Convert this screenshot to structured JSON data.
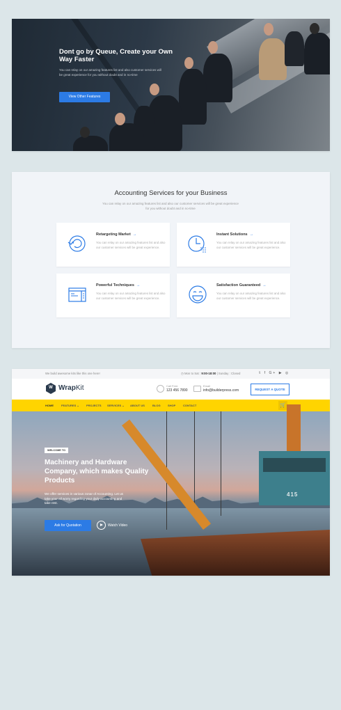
{
  "card1": {
    "title": "Dont go by Queue, Create your Own Way Faster",
    "description": "You can relay on our amazing features list and also customer services will be great experience for you without doubt and in no-time",
    "button": "View Other Features"
  },
  "card2": {
    "heading": "Accounting Services for your Business",
    "subheading": "You can relay on our amazing features list and also our customer services will be great experience for you without doubt and in no-time",
    "services": [
      {
        "title": "Retargeting Market",
        "arrow": "→",
        "desc": "You can relay on our amazing features list and also our customer services will be great experience.",
        "icon": "retargeting-icon"
      },
      {
        "title": "Instant Solutions",
        "arrow": "→",
        "desc": "You can relay on our amazing features list and also our customer services will be great experience.",
        "icon": "clock-icon"
      },
      {
        "title": "Powerful Techniques",
        "arrow": "→",
        "desc": "You can relay on our amazing features list and also our customer services will be great experience.",
        "icon": "browser-window-icon"
      },
      {
        "title": "Satisfaction Guaranteed",
        "arrow": "→",
        "desc": "You can relay on our amazing features list and also our customer services will be great experience.",
        "icon": "smiley-icon"
      }
    ]
  },
  "card3": {
    "topbar": {
      "tagline": "We build awesome kits like this one here!",
      "hours_prefix": "Mon to Sat :",
      "hours": "9:00-18:00",
      "hours_suffix": "| Sunday : Closed",
      "social": "𝕥 f G+ ▶ ◎"
    },
    "logo": {
      "mark": "W",
      "bold": "Wrap",
      "light": "Kit"
    },
    "call": {
      "label": "Call Free:",
      "value": "123 456 7890"
    },
    "email": {
      "label": "Email",
      "value": "info@builderpress.com"
    },
    "quote_button": "REQUEST A QUOTE",
    "nav": [
      "HOME",
      "FEATURES ⌄",
      "PROJECTS",
      "SERVICES ⌄",
      "ABOUT US",
      "BLOG",
      "SHOP",
      "CONTACT"
    ],
    "cart_icon": "🛒",
    "hero": {
      "badge": "WELCOME TO",
      "title": "Machinery and Hardware Company, which makes Quality Products",
      "description": "We offer services in various zonar of Accounting. Let us take your all worry regarding your daily accounting and take rest.",
      "cta": "Ask for Quotation",
      "video": "Watch Video",
      "crane_number": "415"
    }
  }
}
